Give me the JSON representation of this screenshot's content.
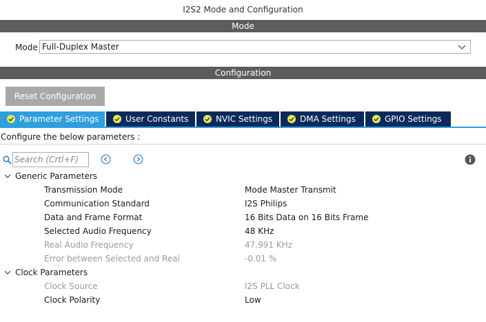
{
  "window": {
    "title": "I2S2 Mode and Configuration"
  },
  "mode_section": {
    "header": "Mode",
    "label": "Mode",
    "selected": "Full-Duplex Master"
  },
  "config_section": {
    "header": "Configuration",
    "reset_label": "Reset Configuration"
  },
  "tabs": [
    {
      "label": "Parameter Settings",
      "active": true
    },
    {
      "label": "User Constants",
      "active": false
    },
    {
      "label": "NVIC Settings",
      "active": false
    },
    {
      "label": "DMA Settings",
      "active": false
    },
    {
      "label": "GPIO Settings",
      "active": false
    }
  ],
  "configure_text": "Configure the below parameters :",
  "search": {
    "placeholder": "Search (Crtl+F)"
  },
  "groups": [
    {
      "label": "Generic Parameters",
      "params": [
        {
          "name": "Transmission Mode",
          "value": "Mode Master Transmit",
          "enabled": true
        },
        {
          "name": "Communication Standard",
          "value": "I2S Philips",
          "enabled": true
        },
        {
          "name": "Data and Frame Format",
          "value": "16 Bits Data on 16 Bits Frame",
          "enabled": true
        },
        {
          "name": "Selected Audio Frequency",
          "value": "48 KHz",
          "enabled": true
        },
        {
          "name": "Real Audio Frequency",
          "value": "47.991 KHz",
          "enabled": false
        },
        {
          "name": "Error between Selected and Real",
          "value": "-0.01 %",
          "enabled": false
        }
      ]
    },
    {
      "label": "Clock Parameters",
      "params": [
        {
          "name": "Clock Source",
          "value": "I2S PLL Clock",
          "enabled": false
        },
        {
          "name": "Clock Polarity",
          "value": "Low",
          "enabled": true
        }
      ]
    }
  ],
  "colors": {
    "section_bar": "#5c5c5c",
    "tab_active": "#2f9fe0",
    "tab_inactive": "#0a2a5c",
    "check_badge": "#e8e85a",
    "disabled_text": "#9a9a9a"
  }
}
